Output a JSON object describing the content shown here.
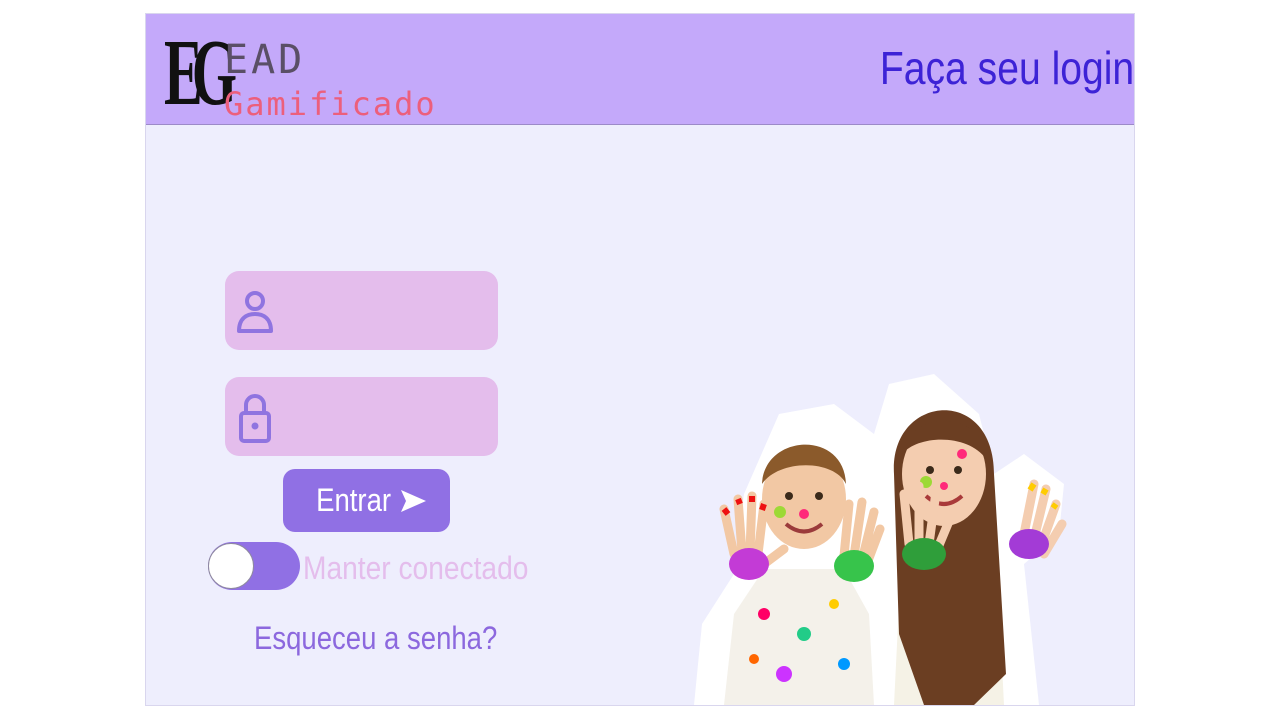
{
  "header": {
    "logo": {
      "mark": "EG",
      "line1": "EAD",
      "line2": "Gamificado"
    },
    "title": "Faça seu login"
  },
  "form": {
    "username": {
      "value": "",
      "placeholder": ""
    },
    "password": {
      "value": "",
      "placeholder": ""
    },
    "submit_label": "Entrar",
    "keep_connected": {
      "label": "Manter conectado",
      "enabled": false
    },
    "forgot_label": "Esqueceu a senha?"
  },
  "icons": {
    "username": "user-icon",
    "password": "lock-icon",
    "submit": "send-arrow-icon"
  },
  "colors": {
    "header_bg": "#c4a9fa",
    "page_bg": "#eeeefd",
    "title": "#3d23d6",
    "field_bg": "#e4bdec",
    "accent": "#9070e4",
    "link": "#8c68de",
    "logo_pink": "#ec5f7c"
  },
  "illustration": "children-painted-hands-photo"
}
